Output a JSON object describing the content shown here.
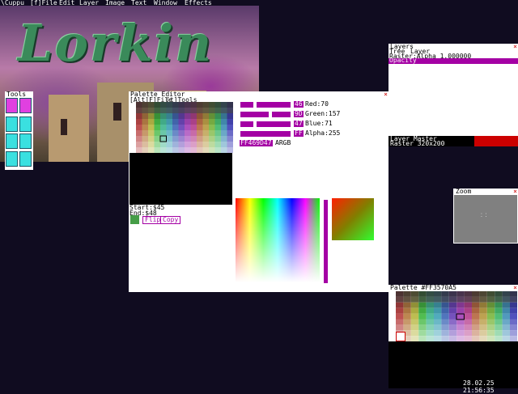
{
  "menubar": {
    "items": [
      "\\Cuppu",
      "[f]File",
      "Edit",
      "Layer",
      "Image",
      "Text",
      "Window",
      "Effects"
    ]
  },
  "logo_text": "Lorkin",
  "tools": {
    "title": "Tools"
  },
  "palette_editor": {
    "title": "Palette Editor",
    "menu": [
      "[Alt]F]File",
      "[t]Tools"
    ],
    "red": {
      "hex": "46",
      "label": "Red:70"
    },
    "green": {
      "hex": "9D",
      "label": "Green:157"
    },
    "blue": {
      "hex": "47",
      "label": "Blue:71"
    },
    "alpha": {
      "hex": "FF",
      "label": "Alpha:255"
    },
    "argb_value": "FF469D47",
    "argb_label": "ARGB",
    "start": "Start:$45",
    "end": "End:$48",
    "flip_label": "Flip",
    "copy_label": "Copy",
    "selected_color": "#469d47"
  },
  "layers": {
    "title": "Layers",
    "tabs": [
      "Tree",
      "Layer"
    ],
    "raster_alpha": "Raster:Alpha 1.000000",
    "opacity_label": "Opacity"
  },
  "layer_master": {
    "title": "Layer Master",
    "info": "Raster 320x200"
  },
  "zoom": {
    "title": "Zoom"
  },
  "palette": {
    "title": "Palette #FF3570A5"
  },
  "clock": "28.02.25 21:56:35",
  "colors": {
    "accent": "#a400a4",
    "cyan": "#3ae0e0",
    "bg": "#100c20",
    "close": "#cc0000"
  }
}
